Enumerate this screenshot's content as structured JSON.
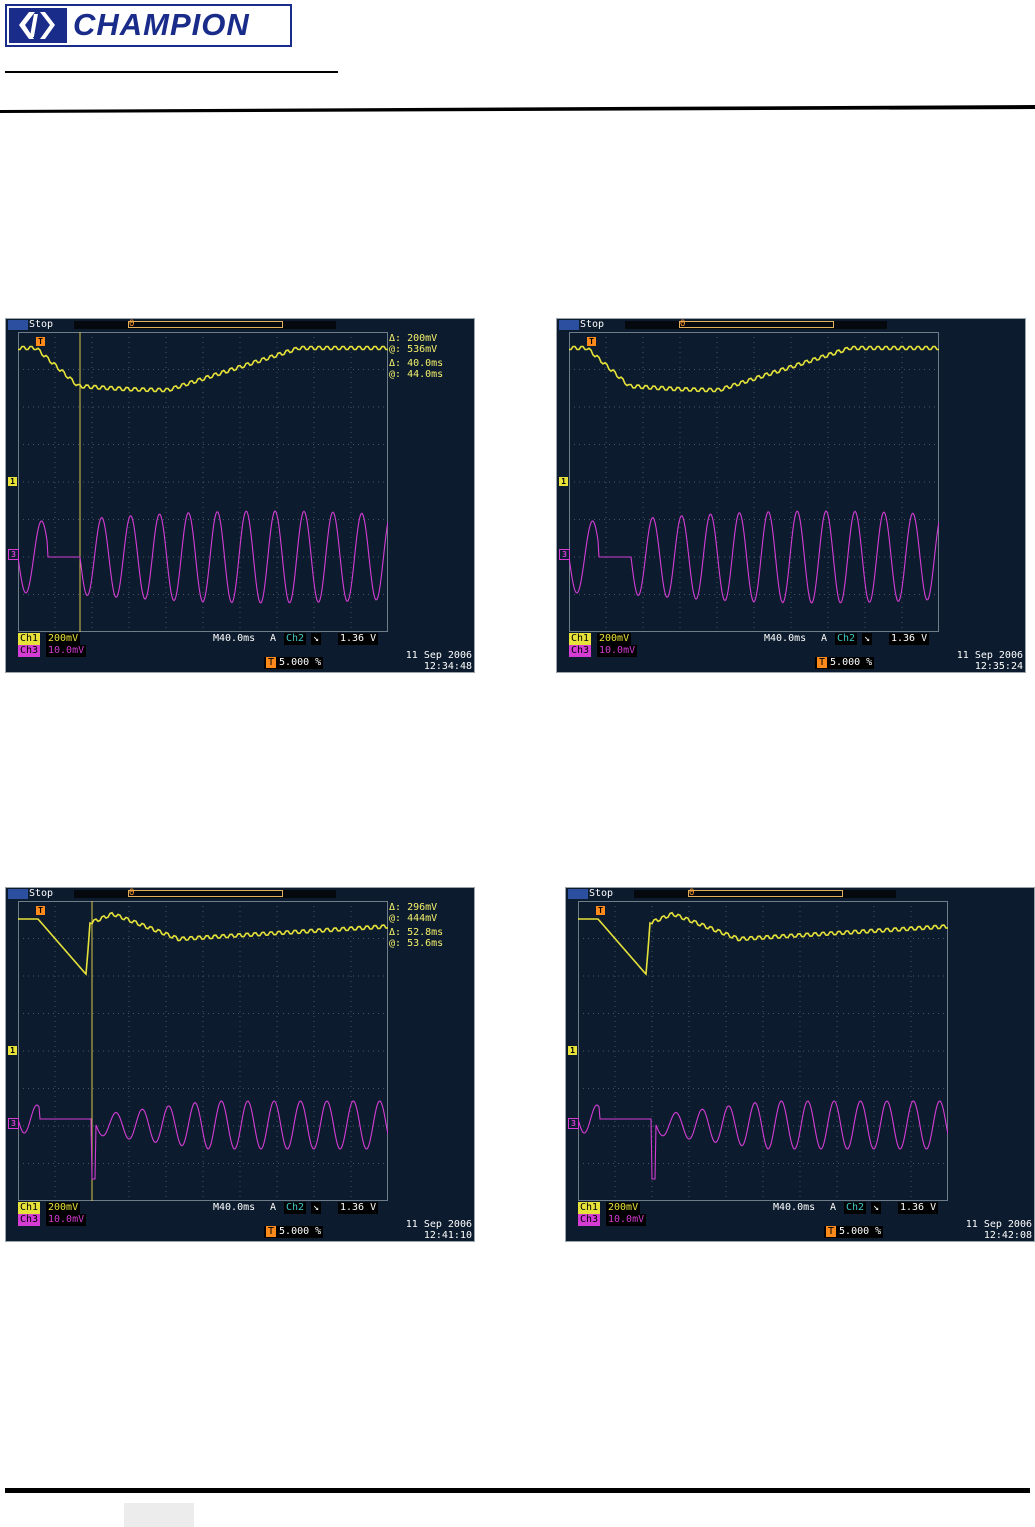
{
  "header": {
    "logo_text": "CHAMPION"
  },
  "colors": {
    "ch1": "#e6e23a",
    "ch3": "#d43cd4",
    "ch2": "#3dc8c8",
    "screen_bg": "#0c1c2e",
    "brand": "#1a2c8a"
  },
  "scopes": [
    {
      "run_state": "Stop",
      "readout": {
        "dv": "200mV",
        "av": "536mV",
        "dt": "40.0ms",
        "at": "44.0ms"
      },
      "ch1_scale": "200mV",
      "ch3_scale": "10.0mV",
      "timebase": "M40.0ms",
      "trig_src": "Ch2",
      "trig_level": "1.36 V",
      "trig_pos": "5.000 %",
      "date": "11 Sep  2006",
      "time": "12:34:48"
    },
    {
      "run_state": "Stop",
      "readout": null,
      "ch1_scale": "200mV",
      "ch3_scale": "10.0mV",
      "timebase": "M40.0ms",
      "trig_src": "Ch2",
      "trig_level": "1.36 V",
      "trig_pos": "5.000 %",
      "date": "11 Sep  2006",
      "time": "12:35:24"
    },
    {
      "run_state": "Stop",
      "readout": {
        "dv": "296mV",
        "av": "444mV",
        "dt": "52.8ms",
        "at": "53.6ms"
      },
      "ch1_scale": "200mV",
      "ch3_scale": "10.0mV",
      "timebase": "M40.0ms",
      "trig_src": "Ch2",
      "trig_level": "1.36 V",
      "trig_pos": "5.000 %",
      "date": "11 Sep  2006",
      "time": "12:41:10"
    },
    {
      "run_state": "Stop",
      "readout": null,
      "ch1_scale": "200mV",
      "ch3_scale": "10.0mV",
      "timebase": "M40.0ms",
      "trig_src": "Ch2",
      "trig_level": "1.36 V",
      "trig_pos": "5.000 %",
      "date": "11 Sep  2006",
      "time": "12:42:08"
    }
  ]
}
